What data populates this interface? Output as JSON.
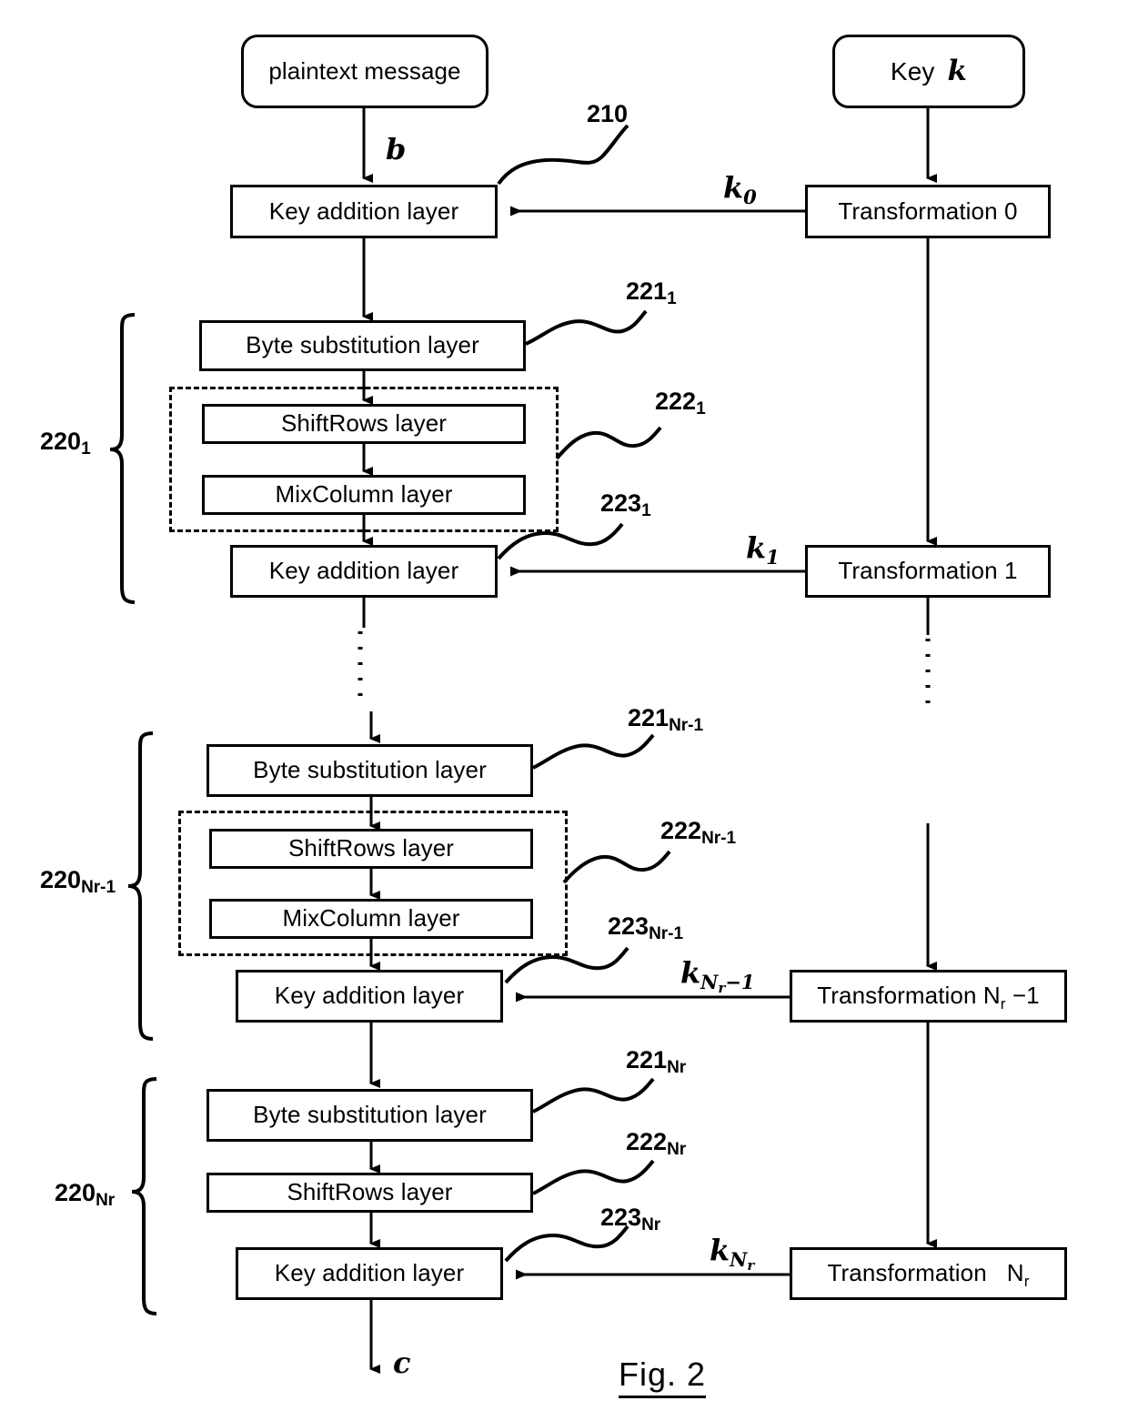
{
  "figure": {
    "caption": "Fig.  2",
    "type": "aes-block-cipher-flowchart"
  },
  "inputs": {
    "plaintext_label": "plaintext message",
    "key_label": "Key",
    "key_symbol": "k",
    "data_symbol": "b",
    "output_symbol": "c"
  },
  "layers": {
    "key_addition": "Key addition layer",
    "byte_substitution": "Byte substitution layer",
    "shiftrows": "ShiftRows layer",
    "mixcolumn": "MixColumn layer"
  },
  "transformations": {
    "t0": "Transformation 0",
    "t1": "Transformation 1",
    "tnr1_name": "Transformation",
    "tnr1_index": "N",
    "tnr1_sub": "r",
    "tnr1_suffix": "−1",
    "tnr_name": "Transformation",
    "tnr_index": "N",
    "tnr_sub": "r"
  },
  "roundkeys": {
    "k0_base": "k",
    "k0_sub": "0",
    "k1_base": "k",
    "k1_sub": "1",
    "knr1_base": "k",
    "knr1_sub": "N",
    "knr1_sub2": "r",
    "knr1_suffix": "−1",
    "knr_base": "k",
    "knr_sub": "N",
    "knr_sub2": "r"
  },
  "refs": {
    "r210": "210",
    "r220_1_base": "220",
    "r220_1_sub": "1",
    "r221_1_base": "221",
    "r221_1_sub": "1",
    "r222_1_base": "222",
    "r222_1_sub": "1",
    "r223_1_base": "223",
    "r223_1_sub": "1",
    "r220_nr1_base": "220",
    "r220_nr1_sub": "Nr-1",
    "r221_nr1_base": "221",
    "r221_nr1_sub": "Nr-1",
    "r222_nr1_base": "222",
    "r222_nr1_sub": "Nr-1",
    "r223_nr1_base": "223",
    "r223_nr1_sub": "Nr-1",
    "r220_nr_base": "220",
    "r220_nr_sub": "Nr",
    "r221_nr_base": "221",
    "r221_nr_sub": "Nr",
    "r222_nr_base": "222",
    "r222_nr_sub": "Nr",
    "r223_nr_base": "223",
    "r223_nr_sub": "Nr"
  },
  "colors": {
    "stroke": "#000000",
    "background": "#ffffff"
  }
}
